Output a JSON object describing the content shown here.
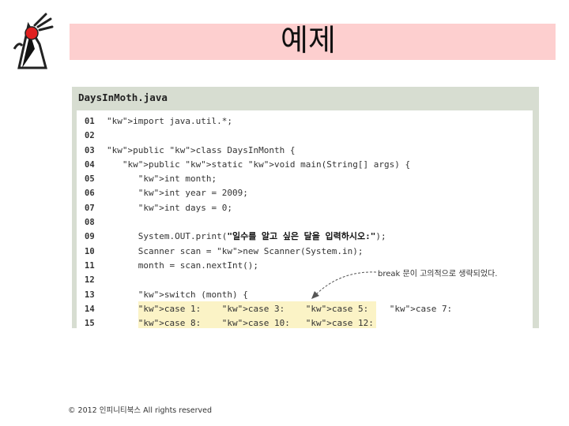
{
  "slide": {
    "title": "예제",
    "footer": "© 2012 인피니티북스  All rights reserved"
  },
  "code": {
    "file_name": "DaysInMoth.java",
    "lines": [
      {
        "num": "01",
        "text": "import java.util.*;"
      },
      {
        "num": "02",
        "text": ""
      },
      {
        "num": "03",
        "text": "public class DaysInMonth {"
      },
      {
        "num": "04",
        "text": "   public static void main(String[] args) {"
      },
      {
        "num": "05",
        "text": "      int month;"
      },
      {
        "num": "06",
        "text": "      int year = 2009;"
      },
      {
        "num": "07",
        "text": "      int days = 0;"
      },
      {
        "num": "08",
        "text": ""
      },
      {
        "num": "09",
        "text": "      System.OUT.print(\"일수를 알고 싶은 달을 입력하시오:\");"
      },
      {
        "num": "10",
        "text": "      Scanner scan = new Scanner(System.in);"
      },
      {
        "num": "11",
        "text": "      month = scan.nextInt();"
      },
      {
        "num": "12",
        "text": ""
      },
      {
        "num": "13",
        "text": "      switch (month) {"
      },
      {
        "num": "14",
        "text": "      case 1:    case 3:    case 5:    case 7:"
      },
      {
        "num": "15",
        "text": "      case 8:    case 10:   case 12:"
      }
    ],
    "annotation": "break 문이 고의적으로 생략되었다."
  },
  "colors": {
    "title_bar": "#fdcfcf",
    "panel": "#d7ddd1",
    "highlight": "#fbf3c6",
    "keyword": "#1a1a8c"
  },
  "icons": {
    "logo": "java-duke-icon"
  }
}
